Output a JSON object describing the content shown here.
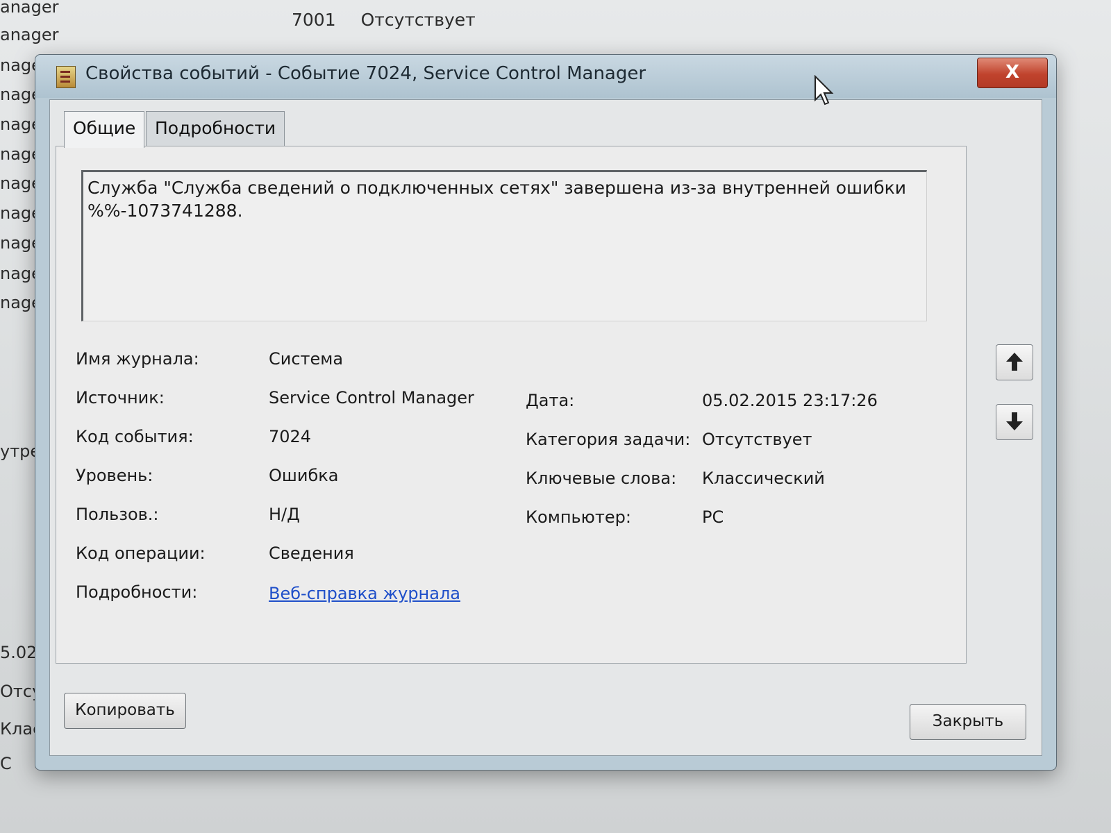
{
  "background": {
    "top_row": {
      "code": "7001",
      "task": "Отсутствует"
    },
    "left_column": [
      "anager",
      "anager",
      "nage",
      "nage",
      "nage",
      "nage",
      "nage",
      "nage",
      "nage",
      "nage",
      "nage",
      "утре",
      "5.02",
      "Отсу",
      "Клас",
      "C"
    ]
  },
  "window": {
    "title": "Свойства событий - Событие 7024, Service Control Manager",
    "close_label": "X"
  },
  "tabs": [
    {
      "label": "Общие",
      "active": true
    },
    {
      "label": "Подробности",
      "active": false
    }
  ],
  "message": "Служба \"Служба сведений о подключенных сетях\" завершена из-за внутренней ошибки %%-1073741288.",
  "fields_left": [
    {
      "label": "Имя журнала:",
      "value": "Система"
    },
    {
      "label": "Источник:",
      "value": "Service Control Manager"
    },
    {
      "label": "Код события:",
      "value": "7024"
    },
    {
      "label": "Уровень:",
      "value": "Ошибка"
    },
    {
      "label": "Пользов.:",
      "value": "Н/Д"
    },
    {
      "label": "Код операции:",
      "value": "Сведения"
    },
    {
      "label": "Подробности:",
      "value": "Веб-справка журнала"
    }
  ],
  "fields_right": [
    {
      "label": "Дата:",
      "value": "05.02.2015 23:17:26"
    },
    {
      "label": "Категория задачи:",
      "value": "Отсутствует"
    },
    {
      "label": "Ключевые слова:",
      "value": "Классический"
    },
    {
      "label": "Компьютер:",
      "value": "PC"
    }
  ],
  "buttons": {
    "copy": "Копировать",
    "close": "Закрыть"
  },
  "icons": {
    "up": "arrow-up-icon",
    "down": "arrow-down-icon"
  }
}
